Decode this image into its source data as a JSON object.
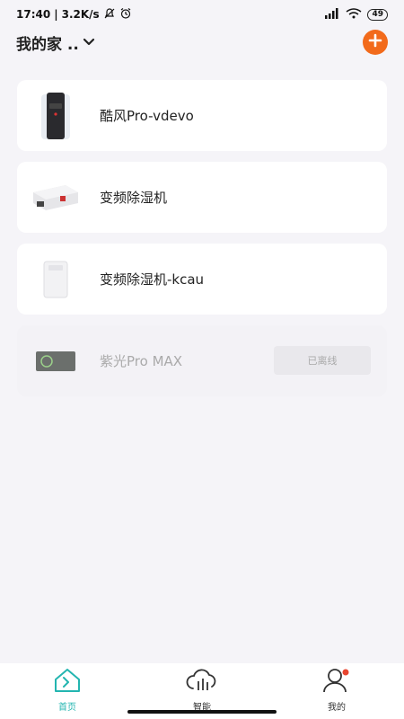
{
  "status_bar": {
    "time": "17:40",
    "speed": "3.2K/s",
    "battery": "49"
  },
  "header": {
    "home_name": "我的家 .."
  },
  "devices": [
    {
      "name": "酷风Pro-vdevo",
      "icon": "tower-air-purifier"
    },
    {
      "name": "变频除湿机",
      "icon": "ceiling-dehumidifier"
    },
    {
      "name": "变频除湿机-kcau",
      "icon": "portable-dehumidifier"
    },
    {
      "name": "紫光Pro MAX",
      "icon": "sterilizer-panel",
      "status": "已离线"
    }
  ],
  "tab_bar": {
    "tabs": [
      {
        "label": "首页",
        "icon": "home-icon",
        "active": true
      },
      {
        "label": "智能",
        "icon": "smart-cloud-icon",
        "active": false
      },
      {
        "label": "我的",
        "icon": "profile-icon",
        "active": false
      }
    ]
  },
  "colors": {
    "accent": "#23b5b0",
    "add_button": "#f26a1b",
    "background": "#f5f4f8"
  }
}
